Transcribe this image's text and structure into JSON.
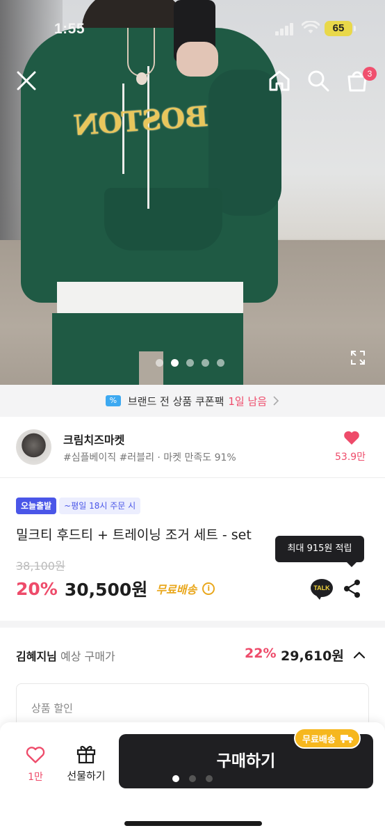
{
  "status_bar": {
    "time": "1:55",
    "battery": "65"
  },
  "header": {
    "cart_count": "3"
  },
  "gallery": {
    "total_images": 5,
    "current_index": 2,
    "print_text": "BOSTON"
  },
  "coupon_banner": {
    "text": "브랜드 전 상품 쿠폰팩",
    "highlight": "1일 남음",
    "icon_glyph": "%"
  },
  "shop": {
    "name": "크림치즈마켓",
    "tags": "#심플베이직 #러블리 · 마켓 만족도 91%",
    "likes": "53.9만"
  },
  "product": {
    "badge_today": "오늘출발",
    "badge_cutoff": "~평일 18시 주문 시",
    "title": "밀크티 후드티 + 트레이닝 조거 세트 - set",
    "points_tooltip": "최대 915원 적립",
    "original_price": "38,100원",
    "discount": "20%",
    "price": "30,500원",
    "shipping": "무료배송",
    "info_glyph": "i",
    "talk_label": "TALK"
  },
  "expected": {
    "user": "김혜지님",
    "label": " 예상 구매가",
    "discount": "22%",
    "price": "29,610원"
  },
  "discount_box": {
    "label": "상품 할인"
  },
  "bottom_bar": {
    "wish_count": "1만",
    "gift_label": "선물하기",
    "buy_label": "구매하기",
    "shipping_pill": "무료배송",
    "pager_total": 3
  },
  "colors": {
    "accent_pink": "#ee4b6a",
    "today_badge": "#4a56e8",
    "shipping_orange": "#e9a71c",
    "dark_button": "#1f1f22"
  },
  "icons": {
    "close": "close-icon",
    "home": "home-icon",
    "search": "search-icon",
    "cart": "cart-icon",
    "expand": "expand-icon",
    "heart": "heart-icon",
    "gift": "gift-icon",
    "share": "share-icon",
    "talk": "kakao-talk-icon",
    "truck": "truck-icon",
    "chevron_up": "chevron-up-icon"
  }
}
